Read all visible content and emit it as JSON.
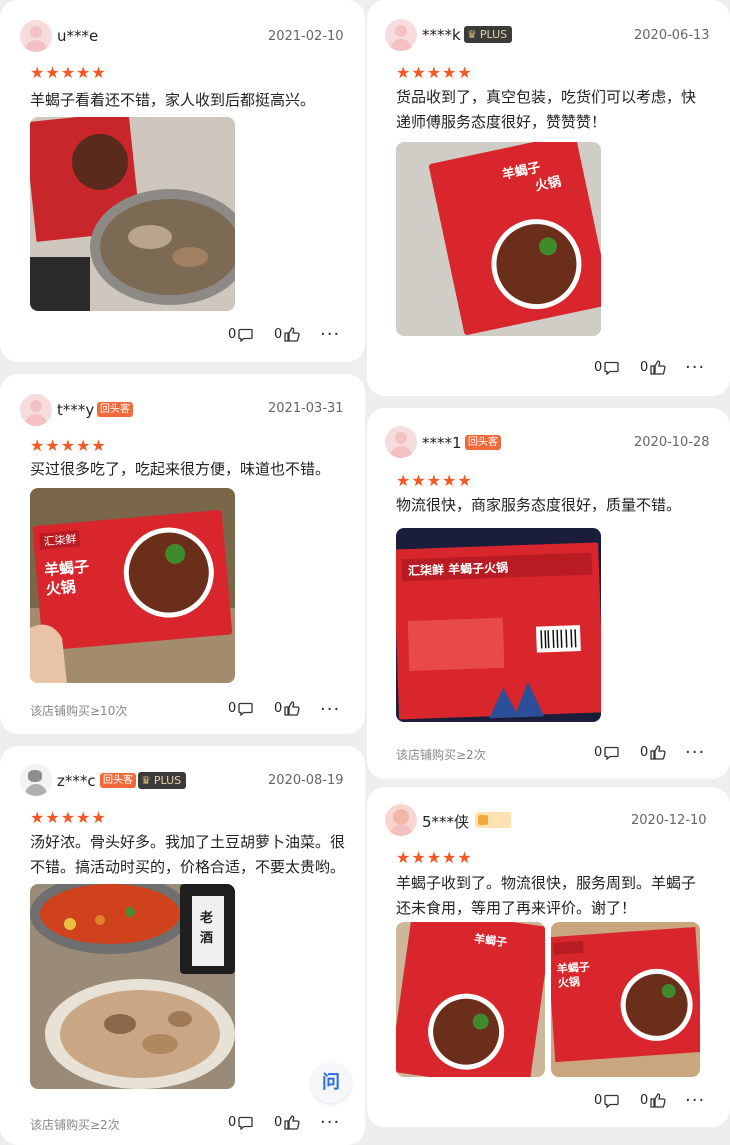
{
  "reviews": [
    {
      "username": "u***e",
      "date": "2021-02-10",
      "stars": "★★★★★",
      "text": "羊蝎子看着还不错，家人收到后都挺高兴。",
      "comments": "0",
      "likes": "0"
    },
    {
      "username": "****k",
      "plus_label": "PLUS",
      "date": "2020-06-13",
      "stars": "★★★★★",
      "text": "货品收到了，真空包装，吃货们可以考虑，快递师傅服务态度很好，赞赞赞！",
      "comments": "0",
      "likes": "0"
    },
    {
      "username": "t***y",
      "badge": "回头客",
      "date": "2021-03-31",
      "stars": "★★★★★",
      "text": "买过很多吃了，吃起来很方便，味道也不错。",
      "footnote": "该店铺购买≥10次",
      "comments": "0",
      "likes": "0"
    },
    {
      "username": "****1",
      "badge": "回头客",
      "date": "2020-10-28",
      "stars": "★★★★★",
      "text": "物流很快，商家服务态度很好，质量不错。",
      "footnote": "该店铺购买≥2次",
      "comments": "0",
      "likes": "0"
    },
    {
      "username": "z***c",
      "badge": "回头客",
      "plus_label": "PLUS",
      "date": "2020-08-19",
      "stars": "★★★★★",
      "text": "汤好浓。骨头好多。我加了土豆胡萝卜油菜。很不错。搞活动时买的，价格合适，不要太贵哟。",
      "footnote": "该店铺购买≥2次",
      "comments": "0",
      "likes": "0"
    },
    {
      "username": "5***侠",
      "date": "2020-12-10",
      "stars": "★★★★★",
      "text": "羊蝎子收到了。物流很快，服务周到。羊蝎子还未食用，等用了再来评价。谢了！",
      "comments": "0",
      "likes": "0"
    }
  ],
  "more_icon": "···",
  "chat_fab_label": "问",
  "colors": {
    "star": "#f15a24",
    "badge": "#f06a3b",
    "package_red": "#d8262c"
  }
}
